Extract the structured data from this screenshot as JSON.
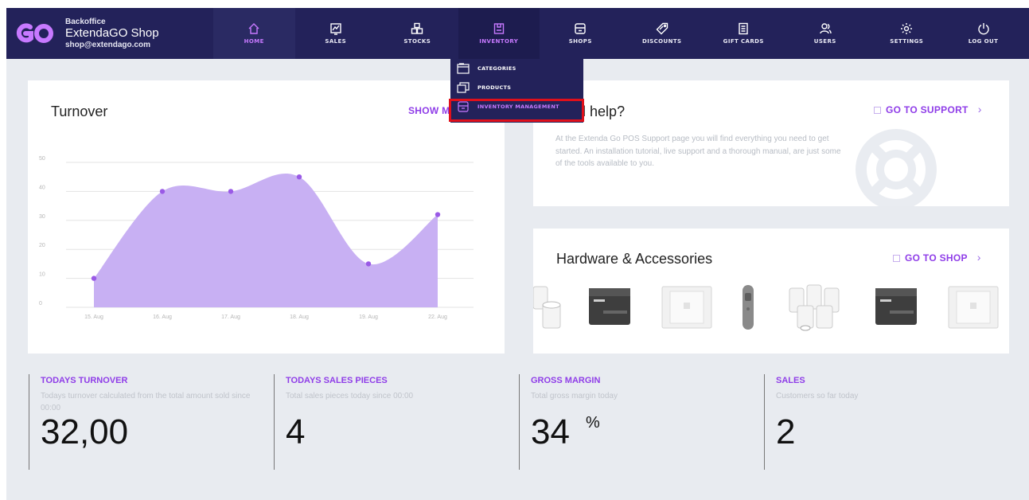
{
  "brand": {
    "section": "Backoffice",
    "shop_name": "ExtendaGO Shop",
    "email": "shop@extendago.com"
  },
  "nav": {
    "items": [
      {
        "label": "HOME",
        "icon": "home-icon"
      },
      {
        "label": "SALES",
        "icon": "sales-icon"
      },
      {
        "label": "STOCKS",
        "icon": "stocks-icon"
      },
      {
        "label": "INVENTORY",
        "icon": "inventory-icon"
      },
      {
        "label": "SHOPS",
        "icon": "shops-icon"
      },
      {
        "label": "DISCOUNTS",
        "icon": "discount-tag-icon"
      },
      {
        "label": "GIFT CARDS",
        "icon": "gift-card-icon"
      },
      {
        "label": "USERS",
        "icon": "users-icon"
      },
      {
        "label": "SETTINGS",
        "icon": "gear-icon"
      },
      {
        "label": "LOG OUT",
        "icon": "power-icon"
      }
    ],
    "active": "INVENTORY"
  },
  "inventory_menu": {
    "items": [
      {
        "label": "CATEGORIES",
        "icon": "categories-icon"
      },
      {
        "label": "PRODUCTS",
        "icon": "products-icon"
      },
      {
        "label": "INVENTORY MANAGEMENT",
        "icon": "inventory-management-icon"
      }
    ],
    "highlighted": "INVENTORY MANAGEMENT"
  },
  "turnover_card": {
    "title": "Turnover",
    "show_more": "SHOW MO"
  },
  "chart_data": {
    "type": "area",
    "x": [
      "15. Aug",
      "16. Aug",
      "17. Aug",
      "18. Aug",
      "19. Aug",
      "22. Aug"
    ],
    "values": [
      10,
      40,
      40,
      45,
      15,
      32
    ],
    "yticks": [
      0,
      10,
      20,
      30,
      40,
      50
    ],
    "ylim": [
      0,
      50
    ],
    "grid": true,
    "color": "#c8b0f3",
    "point_color": "#9a5ae6"
  },
  "support_card": {
    "title": "eed help?",
    "link": "GO TO SUPPORT",
    "text": "At the Extenda Go POS Support page you will find everything you need to get started. An installation tutorial, live support and a thorough manual, are just some of the tools available to you."
  },
  "hardware_card": {
    "title": "Hardware & Accessories",
    "link": "GO TO SHOP",
    "products": [
      "paper-rolls-icon",
      "receipt-printer-icon",
      "tablet-stand-icon",
      "barcode-scanner-icon",
      "paper-rolls-icon",
      "receipt-printer-icon",
      "tablet-stand-icon"
    ]
  },
  "stats": [
    {
      "title": "TODAYS TURNOVER",
      "desc": "Todays turnover calculated from the total amount sold since 00:00",
      "value": "32,00",
      "unit": ""
    },
    {
      "title": "TODAYS SALES PIECES",
      "desc": "Total sales pieces today since 00:00",
      "value": "4",
      "unit": ""
    },
    {
      "title": "GROSS MARGIN",
      "desc": "Total gross margin today",
      "value": "34",
      "unit": "%"
    },
    {
      "title": "SALES",
      "desc": "Customers so far today",
      "value": "2",
      "unit": ""
    }
  ]
}
